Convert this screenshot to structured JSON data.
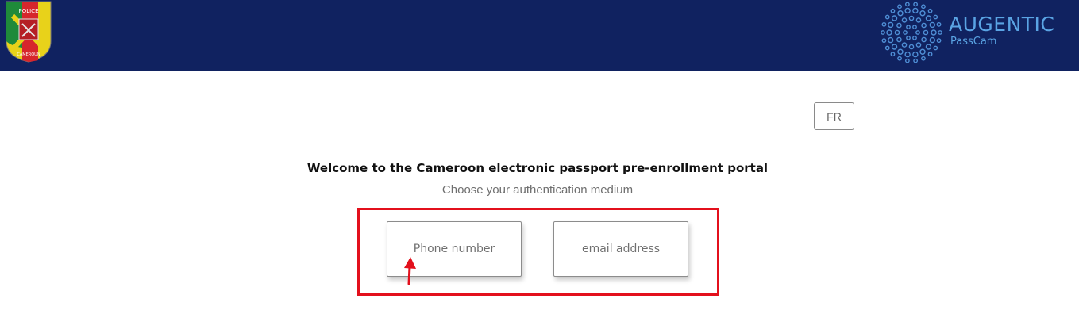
{
  "header": {
    "emblem": {
      "icon": "police-emblem-icon",
      "text_top": "POLICE",
      "text_bottom": "CAMEROUN"
    },
    "brand": {
      "icon": "augentic-dots-logo-icon",
      "name": "AUGENTIC",
      "product": "PassCam"
    },
    "background_color": "#102260"
  },
  "language_toggle": {
    "label": "FR"
  },
  "main": {
    "title": "Welcome to the Cameroon electronic passport pre-enrollment portal",
    "subtitle": "Choose your authentication medium",
    "options": [
      {
        "label": "Phone number"
      },
      {
        "label": "email address"
      }
    ]
  },
  "annotation": {
    "highlight_color": "#e3101c",
    "arrow_icon": "red-arrow-up-icon"
  }
}
